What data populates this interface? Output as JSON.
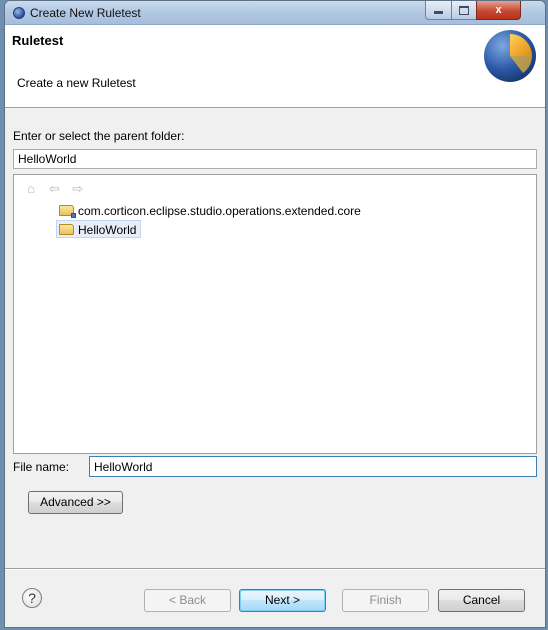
{
  "window": {
    "title": "Create New Ruletest",
    "close_glyph": "x"
  },
  "header": {
    "title": "Ruletest",
    "description": "Create a new Ruletest"
  },
  "parent_folder": {
    "label": "Enter or select the parent folder:",
    "value": "HelloWorld"
  },
  "tree": {
    "toolbar": [
      {
        "name": "home-icon",
        "glyph": "⌂"
      },
      {
        "name": "back-arrow-icon",
        "glyph": "⇦"
      },
      {
        "name": "forward-arrow-icon",
        "glyph": "⇨"
      }
    ],
    "items": [
      {
        "label": "com.corticon.eclipse.studio.operations.extended.core",
        "selected": false
      },
      {
        "label": "HelloWorld",
        "selected": true
      }
    ]
  },
  "file_name": {
    "label": "File name:",
    "value": "HelloWorld"
  },
  "advanced_button": "Advanced >>",
  "help_glyph": "?",
  "footer": {
    "back": "< Back",
    "next": "Next >",
    "finish": "Finish",
    "cancel": "Cancel"
  },
  "colors": {
    "accent": "#3c7fb1",
    "selection": "#e5eef9",
    "close_button": "#c54a33"
  }
}
